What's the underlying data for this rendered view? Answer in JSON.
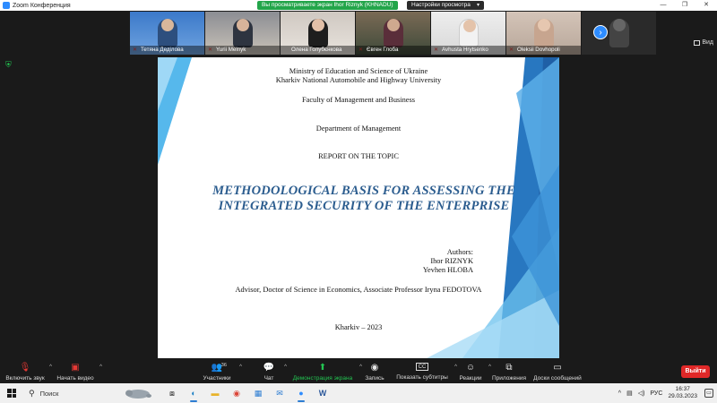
{
  "window": {
    "title": "Zoom Конференция",
    "share_banner": "Вы просматриваете экран Ihor Riznyk (KHNADU)",
    "view_settings": "Настройки просмотра",
    "view_label": "Вид"
  },
  "participants": [
    {
      "name": "Тетяна Деділова"
    },
    {
      "name": "Yurii Melnyk"
    },
    {
      "name": "Олена Голубєнкова"
    },
    {
      "name": "Євген Глоба"
    },
    {
      "name": "Avhusta Hrytsenko"
    },
    {
      "name": "Oleksii Dovhopoli"
    }
  ],
  "slide": {
    "ministry": "Ministry of Education and Science of Ukraine",
    "university": "Kharkiv National Automobile and Highway University",
    "faculty": "Faculty of Management and Business",
    "department": "Department of Management",
    "report": "REPORT ON THE TOPIC",
    "headline_line1": "METHODOLOGICAL BASIS FOR ASSESSING THE",
    "headline_line2": "INTEGRATED SECURITY OF THE ENTERPRISE",
    "authors_label": "Authors:",
    "author1": "Ihor RIZNYK",
    "author2": "Yevhen HLOBA",
    "advisor": "Advisor, Doctor of Science in Economics, Associate Professor Iryna FEDOTOVA",
    "place_year": "Kharkiv – 2023"
  },
  "toolbar": {
    "audio": "Включить звук",
    "video": "Начать видео",
    "participants": "Участники",
    "participants_count": "36",
    "chat": "Чат",
    "share": "Демонстрация экрана",
    "record": "Запись",
    "captions": "Показать субтитры",
    "reactions": "Реакции",
    "apps": "Приложения",
    "whiteboard": "Доски сообщений",
    "leave": "Выйти"
  },
  "taskbar": {
    "search_placeholder": "Поиск",
    "language": "РУС",
    "time": "16:37",
    "date": "29.03.2023",
    "caption_glyph": "CC"
  },
  "colors": {
    "zoom_blue": "#2d8cff",
    "share_green": "#23a54a",
    "headline_blue": "#2c5d8f",
    "leave_red": "#e02828"
  }
}
